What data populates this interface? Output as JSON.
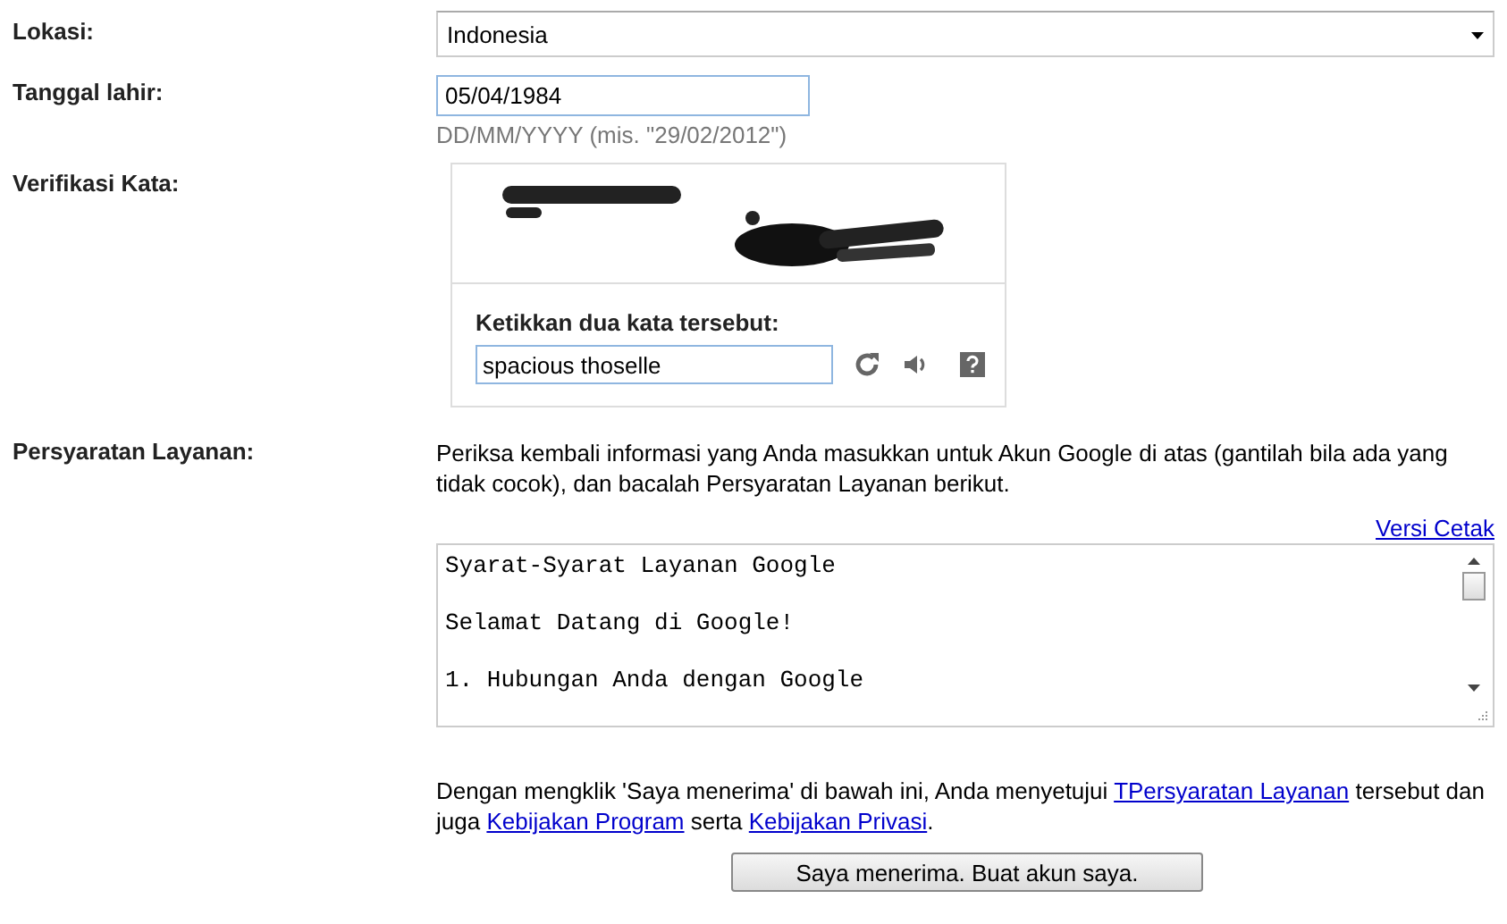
{
  "location": {
    "label": "Lokasi:",
    "value": "Indonesia"
  },
  "birthdate": {
    "label": "Tanggal lahir:",
    "value": "05/04/1984",
    "hint": "DD/MM/YYYY (mis. \"29/02/2012\")"
  },
  "captcha": {
    "label": "Verifikasi Kata:",
    "prompt": "Ketikkan dua kata tersebut:",
    "value": "spacious thoselle"
  },
  "terms": {
    "label": "Persyaratan Layanan:",
    "intro": "Periksa kembali informasi yang Anda masukkan untuk Akun Google di atas (gantilah bila ada yang tidak cocok), dan bacalah Persyaratan Layanan berikut.",
    "print_link": "Versi Cetak",
    "lines": [
      "Syarat-Syarat Layanan Google",
      "Selamat Datang di Google!",
      "1. Hubungan Anda dengan Google"
    ]
  },
  "agreement": [
    {
      "kind": "text",
      "text": "Dengan mengklik 'Saya menerima' di bawah ini, Anda menyetujui "
    },
    {
      "kind": "link",
      "text": "TPersyaratan Layanan"
    },
    {
      "kind": "text",
      "text": " tersebut dan juga "
    },
    {
      "kind": "link",
      "text": "Kebijakan Program"
    },
    {
      "kind": "text",
      "text": " serta "
    },
    {
      "kind": "link",
      "text": "Kebijakan Privasi"
    },
    {
      "kind": "text",
      "text": "."
    }
  ],
  "accept_button": "Saya menerima. Buat akun saya."
}
